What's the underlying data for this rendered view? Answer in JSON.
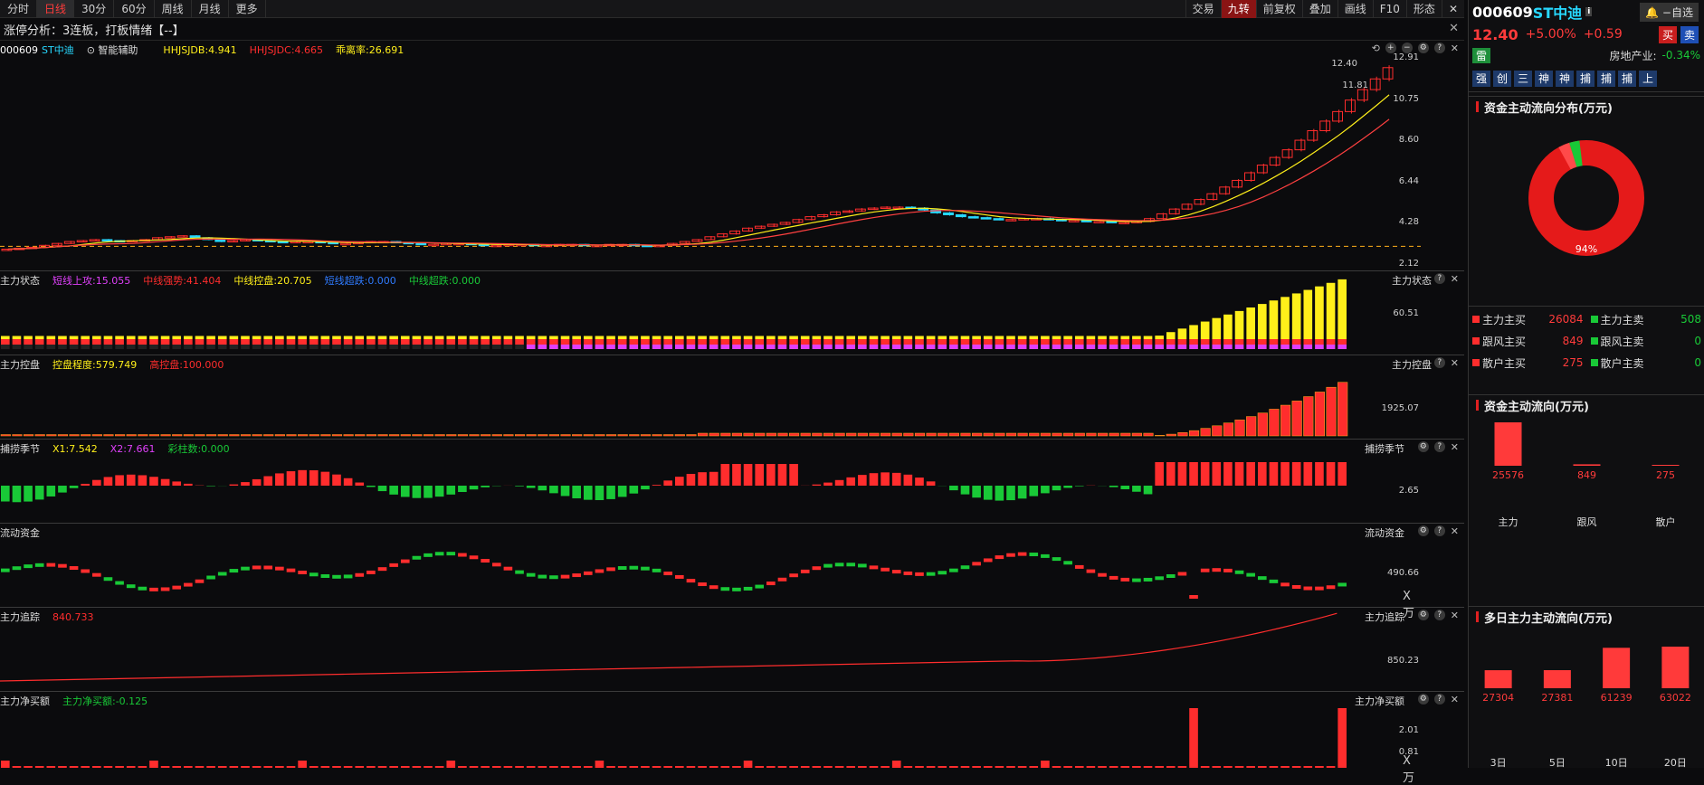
{
  "colors": {
    "up": "#ff2d2d",
    "down": "#19c937",
    "yellow": "#ffef1a",
    "magenta": "#e040fb",
    "cyan": "#27d8ff",
    "orange": "#ffae1a",
    "bg": "#0b0b0d"
  },
  "toolbar": {
    "tabs": [
      "分时",
      "日线",
      "30分",
      "60分",
      "周线",
      "月线",
      "更多"
    ],
    "active": "日线",
    "tools": [
      "交易",
      "九转",
      "前复权",
      "叠加",
      "画线",
      "F10",
      "形态"
    ],
    "active_tool": "九转"
  },
  "analysis": {
    "text": "涨停分析：3连板，打板情绪【--】",
    "close": "✕"
  },
  "main_panel": {
    "code": "000609",
    "name": "ST中迪",
    "assist": "智能辅助",
    "ind1": "HHJSJDB:4.941",
    "ind2": "HHJSJDC:4.665",
    "ind3": "乖离率:26.691",
    "axis": [
      "12.91",
      "10.75",
      "8.60",
      "6.44",
      "4.28",
      "2.12"
    ],
    "price_last": "12.40",
    "price_low": "11.81"
  },
  "panel_status": {
    "title": "主力状态",
    "items": [
      "短线上攻:15.055",
      "中线强势:41.404",
      "中线控盘:20.705",
      "短线超跌:0.000",
      "中线超跌:0.000"
    ],
    "axis": "60.51"
  },
  "panel_control": {
    "title": "主力控盘",
    "items": [
      "控盘程度:579.749",
      "高控盘:100.000"
    ],
    "axis": "1925.07"
  },
  "panel_season": {
    "title": "捕捞季节",
    "items": [
      "X1:7.542",
      "X2:7.661",
      "彩柱数:0.000"
    ],
    "axis": "2.65"
  },
  "panel_liquid": {
    "title": "流动资金",
    "axis": "490.66",
    "unit": "X万"
  },
  "panel_track": {
    "title": "主力追踪",
    "items": [
      "840.733"
    ],
    "axis": "850.23"
  },
  "panel_net": {
    "title": "主力净买额",
    "items": [
      "主力净买额:-0.125"
    ],
    "axis": [
      "2.01",
      "0.81"
    ],
    "unit": "X万"
  },
  "right": {
    "code": "000609",
    "name": "ST中迪",
    "price": "12.40",
    "pct": "+5.00%",
    "chg": "+0.59",
    "star_btn": "自选",
    "buy": "买",
    "sell": "卖",
    "tag": "雷",
    "industry": "房地产业:",
    "industry_pct": "-0.34%",
    "badges": [
      "强",
      "创",
      "三",
      "神",
      "神",
      "捕",
      "捕",
      "捕",
      "上"
    ],
    "dist_title": "资金主动流向分布(万元)",
    "pie_label": "94%",
    "flow_rows": [
      [
        "主力主买",
        "26084",
        "主力主卖",
        "508"
      ],
      [
        "跟风主买",
        "849",
        "跟风主卖",
        "0"
      ],
      [
        "散户主买",
        "275",
        "散户主卖",
        "0"
      ]
    ],
    "flow_title": "资金主动流向(万元)",
    "flow_bars": {
      "labels": [
        "主力",
        "跟风",
        "散户"
      ],
      "values": [
        25576,
        849,
        275
      ]
    },
    "multi_title": "多日主力主动流向(万元)",
    "multi_bars": {
      "labels": [
        "3日",
        "5日",
        "10日",
        "20日"
      ],
      "values": [
        27304,
        27381,
        61239,
        63022
      ]
    }
  },
  "chart_data": {
    "type": "candlestick",
    "close": [
      2.9,
      2.95,
      3.0,
      3.1,
      3.2,
      3.3,
      3.35,
      3.4,
      3.35,
      3.3,
      3.35,
      3.4,
      3.5,
      3.55,
      3.6,
      3.5,
      3.4,
      3.3,
      3.35,
      3.4,
      3.35,
      3.3,
      3.25,
      3.3,
      3.3,
      3.25,
      3.2,
      3.2,
      3.25,
      3.3,
      3.3,
      3.25,
      3.2,
      3.15,
      3.15,
      3.2,
      3.2,
      3.15,
      3.1,
      3.1,
      3.15,
      3.15,
      3.1,
      3.1,
      3.15,
      3.15,
      3.1,
      3.1,
      3.15,
      3.15,
      3.1,
      3.05,
      3.1,
      3.2,
      3.3,
      3.4,
      3.55,
      3.7,
      3.85,
      4.0,
      4.1,
      4.2,
      4.3,
      4.45,
      4.6,
      4.7,
      4.85,
      4.9,
      5.0,
      5.05,
      5.1,
      5.1,
      5.05,
      4.95,
      4.8,
      4.7,
      4.6,
      4.55,
      4.5,
      4.45,
      4.45,
      4.5,
      4.5,
      4.45,
      4.4,
      4.4,
      4.35,
      4.35,
      4.3,
      4.3,
      4.35,
      4.5,
      4.75,
      5.0,
      5.25,
      5.5,
      5.8,
      6.15,
      6.5,
      6.9,
      7.3,
      7.7,
      8.1,
      8.6,
      9.1,
      9.6,
      10.1,
      10.7,
      11.25,
      11.81,
      12.4
    ],
    "ylim": [
      2.12,
      12.91
    ]
  }
}
